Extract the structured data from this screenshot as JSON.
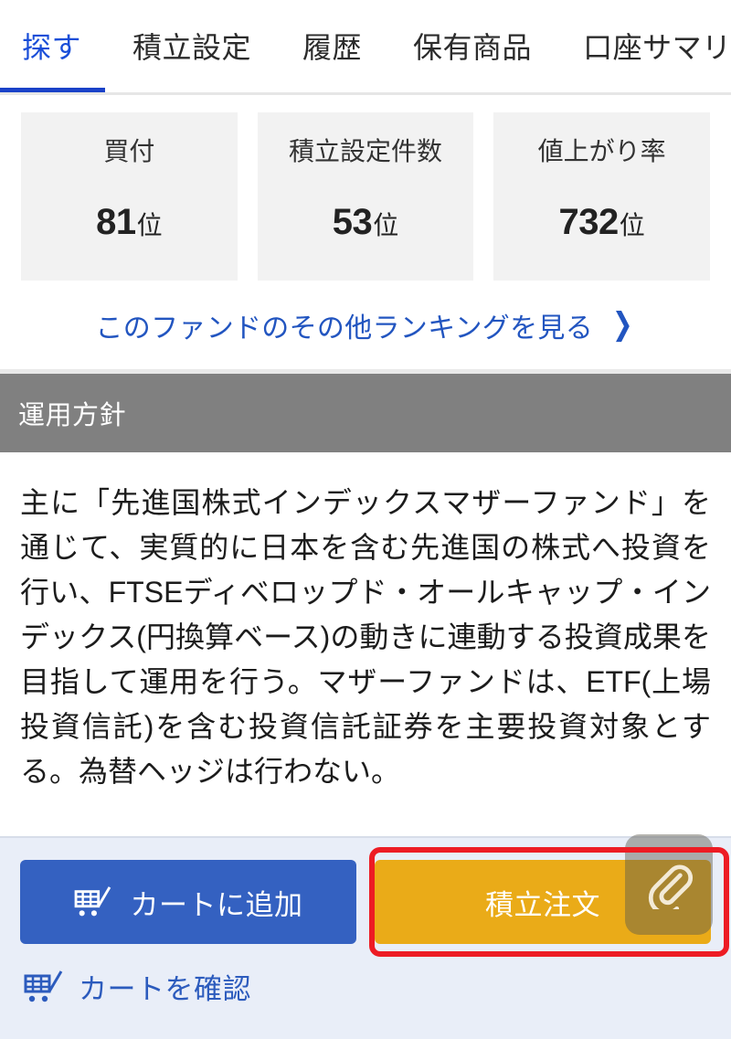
{
  "tabs": [
    {
      "label": "探す",
      "active": true
    },
    {
      "label": "積立設定",
      "active": false
    },
    {
      "label": "履歴",
      "active": false
    },
    {
      "label": "保有商品",
      "active": false
    },
    {
      "label": "口座サマリー",
      "active": false
    }
  ],
  "stats": [
    {
      "label": "買付",
      "value": "81",
      "unit": "位"
    },
    {
      "label": "積立設定件数",
      "value": "53",
      "unit": "位"
    },
    {
      "label": "値上がり率",
      "value": "732",
      "unit": "位"
    }
  ],
  "ranking_link": {
    "label": "このファンドのその他ランキングを見る",
    "chevron": "❯"
  },
  "section": {
    "title": "運用方針",
    "body": "主に「先進国株式インデックスマザーファンド」を通じて、実質的に日本を含む先進国の株式へ投資を行い、FTSEディベロップド・オールキャップ・インデックス(円換算ベース)の動きに連動する投資成果を目指して運用を行う。マザーファンドは、ETF(上場投資信託)を含む投資信託証券を主要投資対象とする。為替ヘッジは行わない。"
  },
  "actions": {
    "add_to_cart_label": "カートに追加",
    "order_label": "積立注文",
    "confirm_cart_label": "カートを確認"
  },
  "colors": {
    "accent_blue": "#1a4ed8",
    "tab_underline": "#1a42c8",
    "link_blue": "#2255c0",
    "cart_button": "#3461c1",
    "order_button": "#eaab18",
    "highlight_red": "#ed1c24",
    "section_bar_gray": "#808080",
    "card_gray": "#f2f2f2",
    "action_bar_bg": "#e9eef8"
  }
}
